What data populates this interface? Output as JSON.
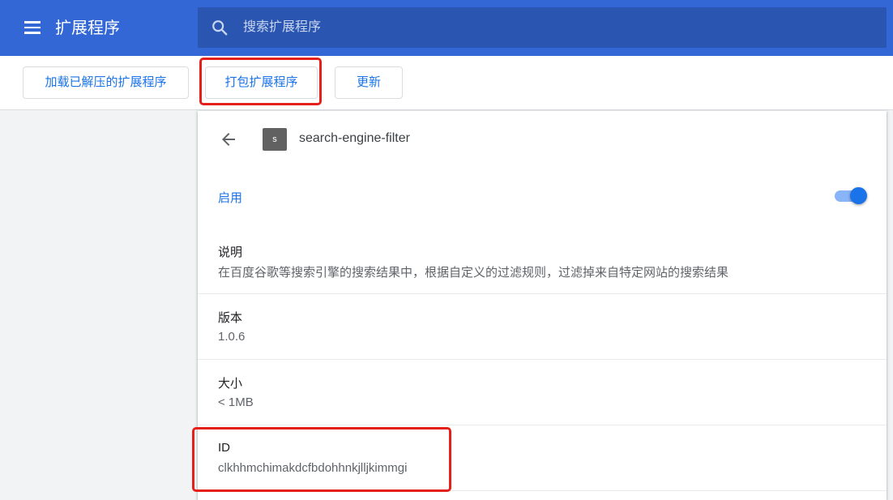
{
  "header": {
    "title": "扩展程序",
    "menu_icon": "menu-icon",
    "search_placeholder": "搜索扩展程序",
    "search_value": "",
    "bg_color": "#3367d6"
  },
  "toolbar": {
    "load_unpacked_label": "加载已解压的扩展程序",
    "pack_label": "打包扩展程序",
    "update_label": "更新"
  },
  "details": {
    "back_icon": "back-arrow-icon",
    "icon_letter": "s",
    "name": "search-engine-filter",
    "enable_label": "启用",
    "enabled": true,
    "rows": [
      {
        "label": "说明",
        "value": "在百度谷歌等搜索引擎的搜索结果中，根据自定义的过滤规则，过滤掉来自特定网站的搜索结果"
      },
      {
        "label": "版本",
        "value": "1.0.6"
      },
      {
        "label": "大小",
        "value": "< 1MB"
      },
      {
        "label": "ID",
        "value": "clkhhmchimakdcfbdohhnkjlljkimmgi"
      }
    ]
  },
  "colors": {
    "accent": "#1a73e8",
    "highlight": "#e5201a"
  }
}
